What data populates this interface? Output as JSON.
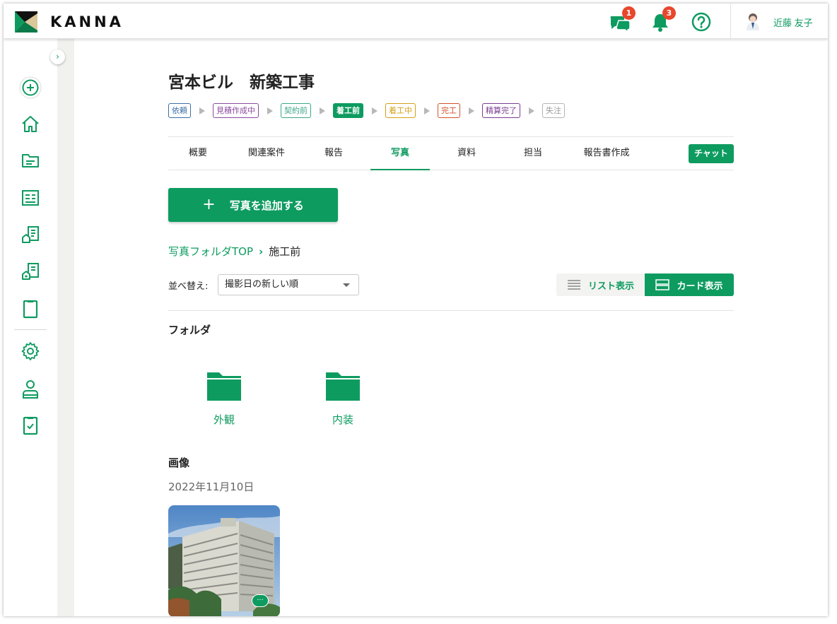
{
  "header": {
    "brand": "KANNA",
    "chat_badge": "1",
    "notification_badge": "3",
    "user_name": "近藤 友子"
  },
  "sidebar": {
    "collapse_glyph": "›",
    "items": [
      "add-circle-icon",
      "home-icon",
      "folder-icon",
      "list-icon",
      "building-report-icon",
      "building-settings-icon",
      "clipboard-icon",
      "gear-icon",
      "user-icon",
      "checklist-icon"
    ]
  },
  "project": {
    "title": "宮本ビル　新築工事"
  },
  "status_steps": [
    {
      "label": "依頼",
      "color": "#3b6ea8"
    },
    {
      "label": "見積作成中",
      "color": "#8b4aa0"
    },
    {
      "label": "契約前",
      "color": "#3ba88a"
    },
    {
      "label": "着工前",
      "color": "#0e9b60",
      "active": true
    },
    {
      "label": "着工中",
      "color": "#d4a017"
    },
    {
      "label": "完工",
      "color": "#d0532b"
    },
    {
      "label": "精算完了",
      "color": "#7a3c91"
    },
    {
      "label": "失注",
      "color": "#9a9a9a"
    }
  ],
  "tabs": [
    "概要",
    "関連案件",
    "報告",
    "写真",
    "資料",
    "担当",
    "報告書作成"
  ],
  "active_tab": "写真",
  "chat_button": "チャット",
  "add_photo_button": "写真を追加する",
  "breadcrumb": {
    "root": "写真フォルダTOP",
    "current": "施工前"
  },
  "sort": {
    "label": "並べ替え:",
    "value": "撮影日の新しい順"
  },
  "view_toggle": {
    "list": "リスト表示",
    "card": "カード表示",
    "selected": "card"
  },
  "folders_section": {
    "title": "フォルダ",
    "items": [
      "外観",
      "内装"
    ]
  },
  "images_section": {
    "title": "画像",
    "date": "2022年11月10日",
    "comment_glyph": "···"
  },
  "colors": {
    "accent": "#0e9b60",
    "badge": "#e8472c"
  }
}
